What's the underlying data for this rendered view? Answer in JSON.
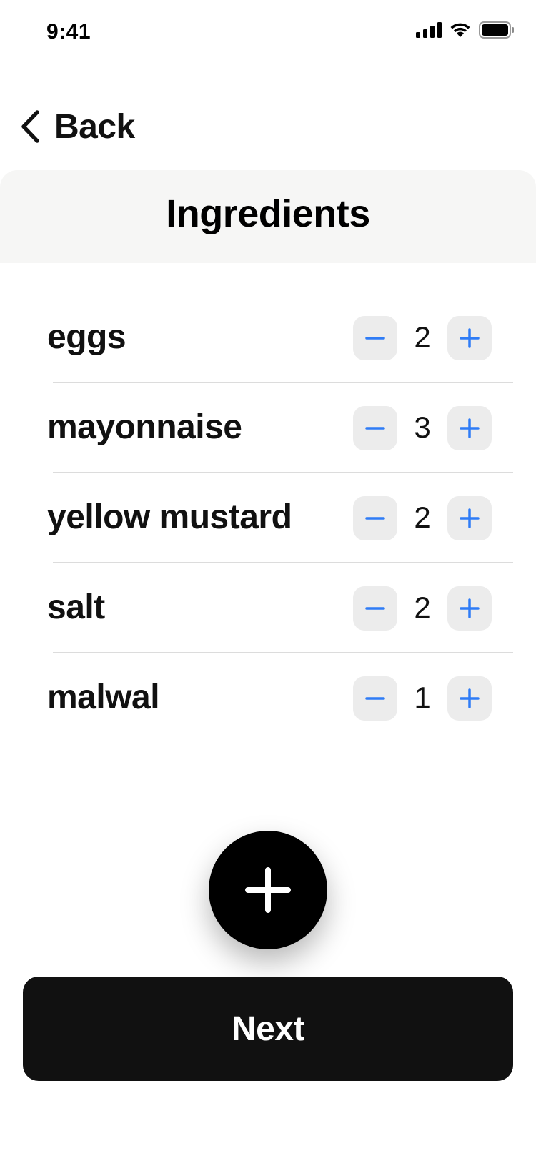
{
  "status_bar": {
    "time": "9:41"
  },
  "nav": {
    "back_label": "Back"
  },
  "header": {
    "title": "Ingredients"
  },
  "ingredients": [
    {
      "name": "eggs",
      "quantity": "2"
    },
    {
      "name": "mayonnaise",
      "quantity": "3"
    },
    {
      "name": "yellow mustard",
      "quantity": "2"
    },
    {
      "name": "salt",
      "quantity": "2"
    },
    {
      "name": "malwal",
      "quantity": "1"
    }
  ],
  "footer": {
    "next_label": "Next"
  },
  "colors": {
    "accent": "#2f7cf6",
    "stepper_bg": "#ececec",
    "header_bg": "#f6f6f5",
    "primary_button": "#111111"
  },
  "icons": {
    "back": "chevron-left-icon",
    "minus": "minus-icon",
    "plus": "plus-icon",
    "add": "plus-icon",
    "signal": "cellular-signal-icon",
    "wifi": "wifi-icon",
    "battery": "battery-icon"
  }
}
